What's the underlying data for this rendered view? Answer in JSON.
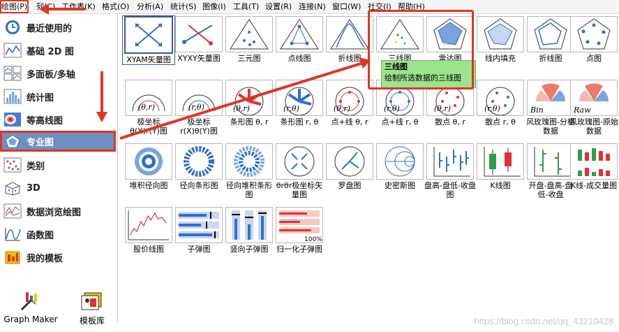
{
  "menubar": {
    "items": [
      "绘图(P)",
      "列(C)",
      "工作表(K)",
      "格式(O)",
      "分析(A)",
      "统计(S)",
      "图像(I)",
      "工具(T)",
      "设置(R)",
      "连接(N)",
      "窗口(W)",
      "社交(I)",
      "帮助(H)"
    ],
    "active": "绘图(P)"
  },
  "sidebar": {
    "items": [
      {
        "label": "最近使用的",
        "icon": "clock-icon"
      },
      {
        "label": "基础 2D 图",
        "icon": "line-chart-icon"
      },
      {
        "label": "多面板/多轴",
        "icon": "multi-panel-icon"
      },
      {
        "label": "统计图",
        "icon": "histogram-icon"
      },
      {
        "label": "等高线图",
        "icon": "contour-icon"
      },
      {
        "label": "专业图",
        "icon": "specialized-chart-icon",
        "selected": true
      },
      {
        "label": "类别",
        "icon": "category-icon"
      },
      {
        "label": "3D",
        "icon": "cube-3d-icon"
      },
      {
        "label": "数据浏览绘图",
        "icon": "data-explore-icon"
      },
      {
        "label": "函数图",
        "icon": "function-plot-icon"
      },
      {
        "label": "我的模板",
        "icon": "template-icon"
      }
    ],
    "bottom": [
      {
        "label": "Graph Maker",
        "icon": "graph-maker-icon"
      },
      {
        "label": "模板库",
        "icon": "template-library-icon"
      }
    ]
  },
  "gallery": {
    "rows": [
      [
        "XYAM矢量图",
        "XYXY矢量图",
        "三元图",
        "点线图",
        "折线图",
        "三线图",
        "雷达图",
        "线内填充",
        "折线图",
        "点图"
      ],
      [
        "极坐标θ(X)r(Y)图",
        "极坐标r(X)θ(Y)图",
        "条形图 θ, r",
        "条形图 r, θ",
        "点+线 θ, r",
        "点+线 r, θ",
        "散点 θ, r",
        "散点 r, θ",
        "风玫瑰图-分格数据",
        "风玫瑰图-原始数据"
      ],
      [
        "堆积径向图",
        "径向条形图",
        "径向堆积条形图",
        "θrθr极坐标矢量图",
        "罗盘图",
        "史密斯图",
        "盘高-盘低-收盘图",
        "K线图",
        "开盘-盘高-盘低-收盘",
        "K线-成交量图"
      ],
      [
        "股价线图",
        "子弹图",
        "竖向子弹图",
        "归一化子弹图"
      ]
    ],
    "tooltip": {
      "title": "三线图",
      "desc": "绘制所选数据的三线图"
    },
    "watermark": "https://blog.csdn.net/qq_43210428",
    "percent_label": "100%",
    "bin_label": "Bin",
    "raw_label": "Raw"
  },
  "colors": {
    "accent_red": "#e03524",
    "selected_blue": "#6f8fbf",
    "tooltip_green": "#9be38d"
  }
}
